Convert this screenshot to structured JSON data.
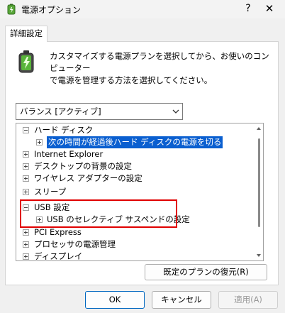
{
  "window": {
    "title": "電源オプション",
    "help_glyph": "?",
    "close_glyph": "✕"
  },
  "tabs": [
    {
      "label": "詳細設定"
    }
  ],
  "description": {
    "line1": "カスタマイズする電源プランを選択してから、お使いのコンピューター",
    "line2": "で電源を管理する方法を選択してください。"
  },
  "plan_select": {
    "selected": "バランス [アクティブ]"
  },
  "tree": {
    "items": [
      {
        "label": "ハード ディスク",
        "expanded": true
      },
      {
        "label": "次の時間が経過後ハード ディスクの電源を切る",
        "expanded": false,
        "selected": true
      },
      {
        "label": "Internet Explorer",
        "expanded": false
      },
      {
        "label": "デスクトップの背景の設定",
        "expanded": false
      },
      {
        "label": "ワイヤレス アダプターの設定",
        "expanded": false
      },
      {
        "label": "スリープ",
        "expanded": false
      },
      {
        "label": "USB 設定",
        "expanded": true
      },
      {
        "label": "USB のセレクティブ サスペンドの設定",
        "expanded": false
      },
      {
        "label": "PCI Express",
        "expanded": false
      },
      {
        "label": "プロセッサの電源管理",
        "expanded": false
      },
      {
        "label": "ディスプレイ",
        "expanded": false
      }
    ]
  },
  "buttons": {
    "restore": "既定のプランの復元(R)",
    "ok": "OK",
    "cancel": "キャンセル",
    "apply": "適用(A)"
  },
  "colors": {
    "selection": "#0a5fd0",
    "highlight_box": "#e00000",
    "accent": "#0067c0"
  }
}
